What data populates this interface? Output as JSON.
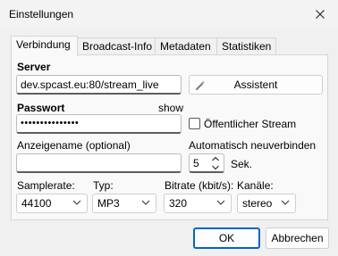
{
  "window": {
    "title": "Einstellungen"
  },
  "tabs": [
    {
      "label": "Verbindung"
    },
    {
      "label": "Broadcast-Info"
    },
    {
      "label": "Metadaten"
    },
    {
      "label": "Statistiken"
    }
  ],
  "server": {
    "label": "Server",
    "value": "dev.spcast.eu:80/stream_live",
    "assistant_label": "Assistent"
  },
  "password": {
    "label": "Passwort",
    "show_label": "show",
    "value": "•••••••••••••••"
  },
  "public_stream": {
    "label": "Öffentlicher Stream",
    "checked": false
  },
  "display_name": {
    "label": "Anzeigename (optional)",
    "value": ""
  },
  "auto_reconnect": {
    "label": "Automatisch neuverbinden",
    "value": "5",
    "unit": "Sek."
  },
  "samplerate": {
    "label": "Samplerate:",
    "value": "44100"
  },
  "type": {
    "label": "Typ:",
    "value": "MP3"
  },
  "bitrate": {
    "label": "Bitrate (kbit/s):",
    "value": "320"
  },
  "channels": {
    "label": "Kanäle:",
    "value": "stereo"
  },
  "buttons": {
    "ok": "OK",
    "cancel": "Abbrechen"
  }
}
